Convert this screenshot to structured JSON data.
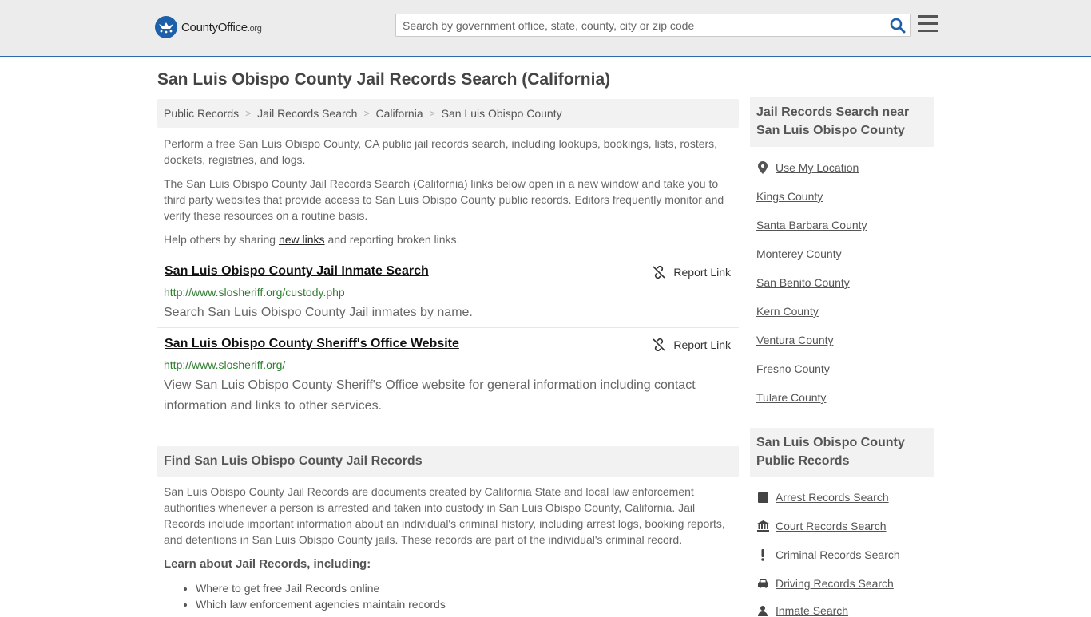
{
  "header": {
    "logo_main": "CountyOffice",
    "logo_suffix": ".org",
    "search_placeholder": "Search by government office, state, county, city or zip code"
  },
  "page": {
    "title": "San Luis Obispo County Jail Records Search (California)",
    "breadcrumb": [
      "Public Records",
      "Jail Records Search",
      "California",
      "San Luis Obispo County"
    ],
    "intro1": "Perform a free San Luis Obispo County, CA public jail records search, including lookups, bookings, lists, rosters, dockets, registries, and logs.",
    "intro2": "The San Luis Obispo County Jail Records Search (California) links below open in a new window and take you to third party websites that provide access to San Luis Obispo County public records. Editors frequently monitor and verify these resources on a routine basis.",
    "help_prefix": "Help others by sharing ",
    "help_link": "new links",
    "help_suffix": " and reporting broken links."
  },
  "results": [
    {
      "title": "San Luis Obispo County Jail Inmate Search",
      "url": "http://www.slosheriff.org/custody.php",
      "desc": "Search San Luis Obispo County Jail inmates by name.",
      "report": "Report Link"
    },
    {
      "title": "San Luis Obispo County Sheriff's Office Website",
      "url": "http://www.slosheriff.org/",
      "desc": "View San Luis Obispo County Sheriff's Office website for general information including contact information and links to other services.",
      "report": "Report Link"
    }
  ],
  "find_section": {
    "heading": "Find San Luis Obispo County Jail Records",
    "body": "San Luis Obispo County Jail Records are documents created by California State and local law enforcement authorities whenever a person is arrested and taken into custody in San Luis Obispo County, California. Jail Records include important information about an individual's criminal history, including arrest logs, booking reports, and detentions in San Luis Obispo County jails. These records are part of the individual's criminal record.",
    "learn_heading": "Learn about Jail Records, including:",
    "bullets": [
      "Where to get free Jail Records online",
      "Which law enforcement agencies maintain records"
    ]
  },
  "sidebar": {
    "nearby_title": "Jail Records Search near San Luis Obispo County",
    "use_location": "Use My Location",
    "nearby": [
      "Kings County",
      "Santa Barbara County",
      "Monterey County",
      "San Benito County",
      "Kern County",
      "Ventura County",
      "Fresno County",
      "Tulare County"
    ],
    "records_title": "San Luis Obispo County Public Records",
    "records": [
      {
        "label": "Arrest Records Search",
        "icon": "square-icon"
      },
      {
        "label": "Court Records Search",
        "icon": "courthouse-icon"
      },
      {
        "label": "Criminal Records Search",
        "icon": "exclamation-icon"
      },
      {
        "label": "Driving Records Search",
        "icon": "car-icon"
      },
      {
        "label": "Inmate Search",
        "icon": "inmate-icon"
      }
    ]
  },
  "colors": {
    "accent": "#2b6cb0",
    "url_green": "#2e7d32",
    "panel_gray": "#f2f2f2"
  }
}
